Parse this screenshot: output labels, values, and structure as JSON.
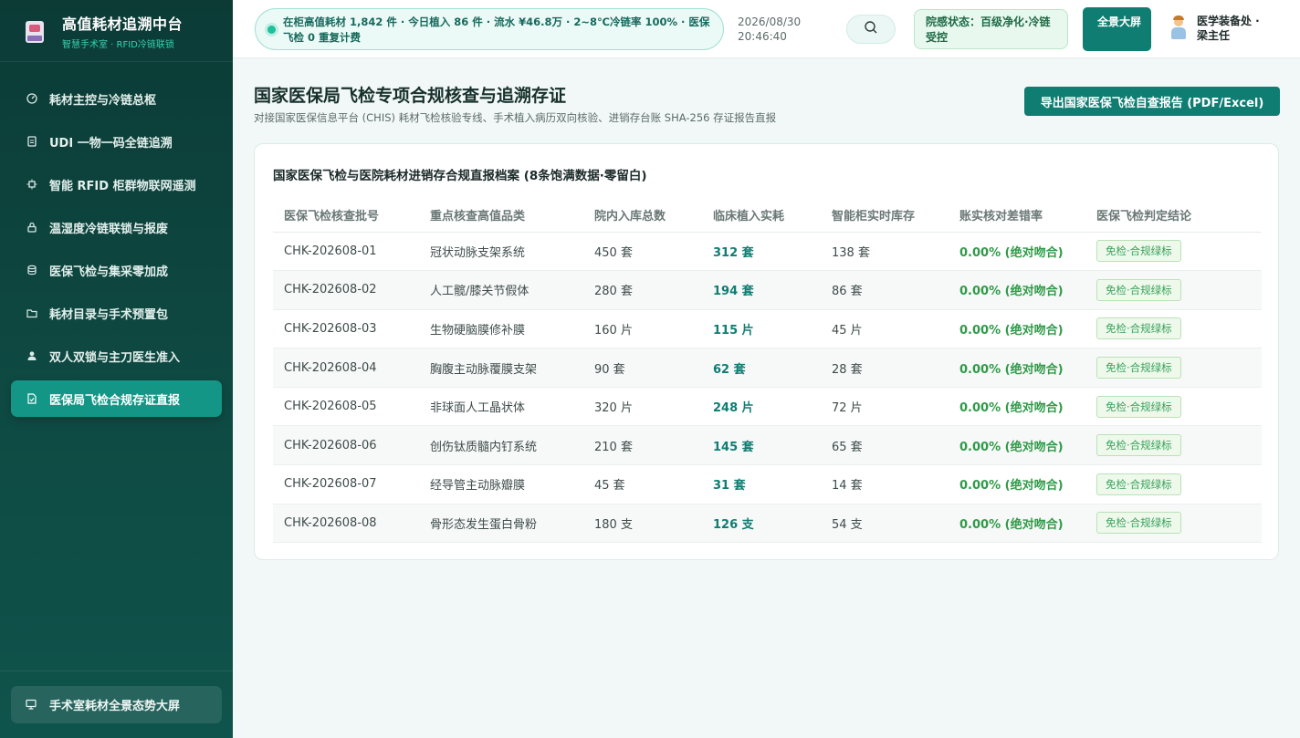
{
  "brand": {
    "title": "高值耗材追溯中台",
    "subtitle": "智慧手术室 · RFID冷链联锁"
  },
  "sidebar": {
    "items": [
      {
        "label": "耗材主控与冷链总枢",
        "icon": "dashboard-icon"
      },
      {
        "label": "UDI 一物一码全链追溯",
        "icon": "document-icon"
      },
      {
        "label": "智能 RFID 柜群物联网遥测",
        "icon": "chip-icon"
      },
      {
        "label": "温湿度冷链联锁与报废",
        "icon": "lock-icon"
      },
      {
        "label": "医保飞检与集采零加成",
        "icon": "database-icon"
      },
      {
        "label": "耗材目录与手术预置包",
        "icon": "folder-icon"
      },
      {
        "label": "双人双锁与主刀医生准入",
        "icon": "user-icon"
      },
      {
        "label": "医保局飞检合规存证直报",
        "icon": "file-check-icon",
        "active": true
      }
    ],
    "bottom_label": "手术室耗材全景态势大屏"
  },
  "topbar": {
    "ticker": "在柜高值耗材 1,842 件 · 今日植入 86 件 · 流水 ¥46.8万 · 2~8℃冷链率 100% · 医保飞检 0 重复计费",
    "date": "2026/08/30",
    "time": "20:46:40",
    "status": "院感状态：百级净化·冷链受控",
    "bigscreen_label": "全景大屏",
    "user_name": "医学装备处 · 梁主任"
  },
  "main": {
    "title": "国家医保局飞检专项合规核查与追溯存证",
    "subtitle": "对接国家医保信息平台 (CHIS) 耗材飞检核验专线、手术植入病历双向核验、进销存台账 SHA-256 存证报告直报",
    "export_label": "导出国家医保飞检自查报告 (PDF/Excel)"
  },
  "table": {
    "title": "国家医保飞检与医院耗材进销存合规直报档案 (8条饱满数据·零留白)",
    "headers": [
      "医保飞检核查批号",
      "重点核查高值品类",
      "院内入库总数",
      "临床植入实耗",
      "智能柜实时库存",
      "账实核对差错率",
      "医保飞检判定结论"
    ],
    "rows": [
      [
        "CHK-202608-01",
        "冠状动脉支架系统",
        "450 套",
        "312 套",
        "138 套",
        "0.00% (绝对吻合)",
        "免检·合规绿标"
      ],
      [
        "CHK-202608-02",
        "人工髋/膝关节假体",
        "280 套",
        "194 套",
        "86 套",
        "0.00% (绝对吻合)",
        "免检·合规绿标"
      ],
      [
        "CHK-202608-03",
        "生物硬脑膜修补膜",
        "160 片",
        "115 片",
        "45 片",
        "0.00% (绝对吻合)",
        "免检·合规绿标"
      ],
      [
        "CHK-202608-04",
        "胸腹主动脉覆膜支架",
        "90 套",
        "62 套",
        "28 套",
        "0.00% (绝对吻合)",
        "免检·合规绿标"
      ],
      [
        "CHK-202608-05",
        "非球面人工晶状体",
        "320 片",
        "248 片",
        "72 片",
        "0.00% (绝对吻合)",
        "免检·合规绿标"
      ],
      [
        "CHK-202608-06",
        "创伤钛质髓内钉系统",
        "210 套",
        "145 套",
        "65 套",
        "0.00% (绝对吻合)",
        "免检·合规绿标"
      ],
      [
        "CHK-202608-07",
        "经导管主动脉瓣膜",
        "45 套",
        "31 套",
        "14 套",
        "0.00% (绝对吻合)",
        "免检·合规绿标"
      ],
      [
        "CHK-202608-08",
        "骨形态发生蛋白骨粉",
        "180 支",
        "126 支",
        "54 支",
        "0.00% (绝对吻合)",
        "免检·合规绿标"
      ]
    ]
  }
}
